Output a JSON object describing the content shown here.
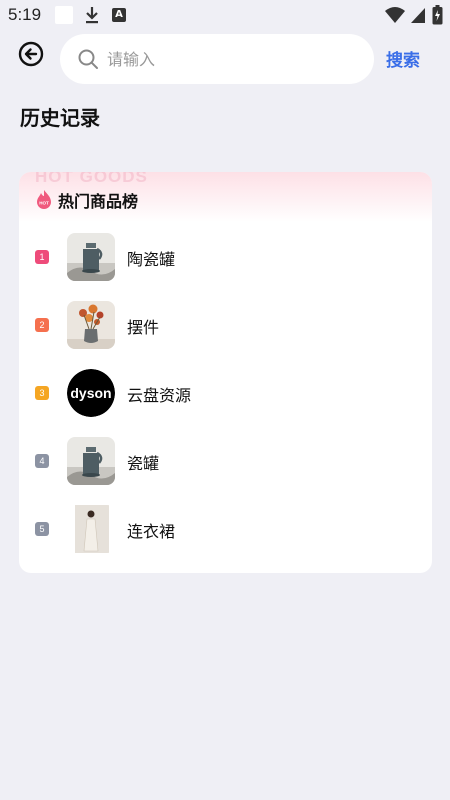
{
  "status_bar": {
    "time": "5:19",
    "notification_icons": [
      "blank-notification-icon",
      "download-icon",
      "text-app-icon"
    ],
    "a_glyph": "A",
    "system_icons": [
      "wifi-icon",
      "signal-icon",
      "battery-icon"
    ]
  },
  "header": {
    "back_icon": "back-arrow-icon",
    "search": {
      "placeholder": "请输入",
      "value": ""
    },
    "search_button": "搜索"
  },
  "history": {
    "title": "历史记录"
  },
  "hot": {
    "watermark": "HOT GOODS",
    "title": "热门商品榜",
    "items": [
      {
        "rank": "1",
        "name": "陶瓷罐",
        "rank_color": "#ee4b7a",
        "thumb": "ceramic-jar"
      },
      {
        "rank": "2",
        "name": "摆件",
        "rank_color": "#f5704e",
        "thumb": "flower-vase"
      },
      {
        "rank": "3",
        "name": "云盘资源",
        "rank_color": "#f5a623",
        "thumb": "dyson-logo",
        "logo_text": "dyson"
      },
      {
        "rank": "4",
        "name": "瓷罐",
        "rank_color": "#8c93a3",
        "thumb": "ceramic-jar"
      },
      {
        "rank": "5",
        "name": "连衣裙",
        "rank_color": "#8c93a3",
        "thumb": "dress-photo"
      }
    ]
  },
  "colors": {
    "accent": "#3a6ee8",
    "background": "#efeff5",
    "hot_header_gradient": "#fde0e6"
  }
}
